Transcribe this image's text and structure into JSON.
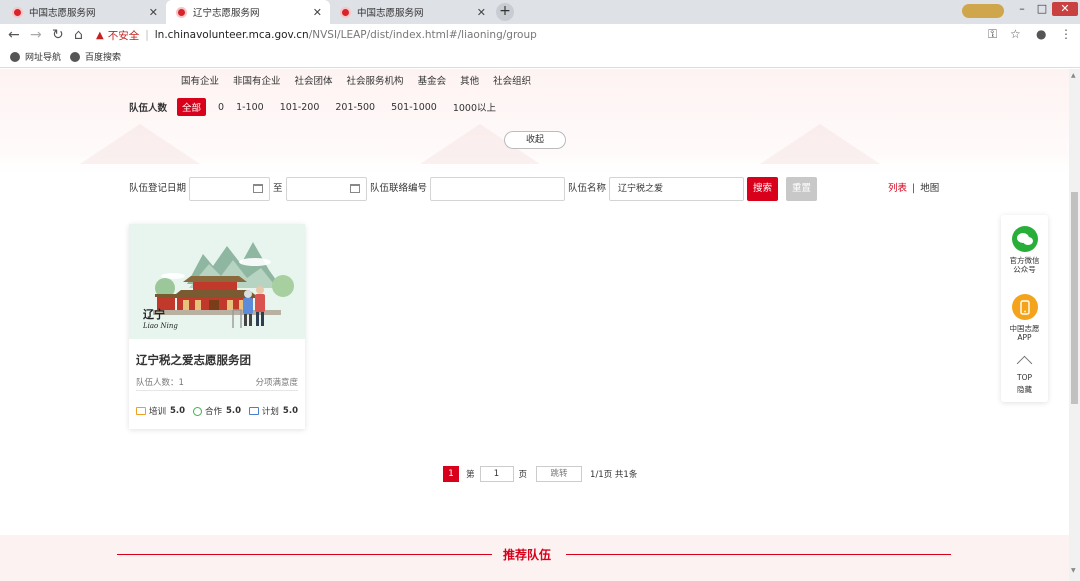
{
  "browser": {
    "tabs": [
      {
        "title": "中国志愿服务网",
        "active": false
      },
      {
        "title": "辽宁志愿服务网",
        "active": true
      },
      {
        "title": "中国志愿服务网",
        "active": false
      }
    ],
    "new_tab": "+",
    "not_secure": "不安全",
    "url_host": "ln.chinavolunteer.mca.gov.cn",
    "url_path": "/NVSI/LEAP/dist/index.html#/liaoning/group",
    "bookmarks": [
      "网址导航",
      "百度搜索"
    ]
  },
  "filters": {
    "org_types": [
      "国有企业",
      "非国有企业",
      "社会团体",
      "社会服务机构",
      "基金会",
      "其他",
      "社会组织"
    ],
    "team_size_label": "队伍人数",
    "team_size_options": [
      "全部",
      "0",
      "1-100",
      "101-200",
      "201-500",
      "501-1000",
      "1000以上"
    ],
    "selected_size": "全部",
    "collapse_label": "收起"
  },
  "search": {
    "date_label": "队伍登记日期",
    "to_label": "至",
    "contact_label": "队伍联络编号",
    "name_label": "队伍名称",
    "name_value": "辽宁税之爱",
    "search_button": "搜索",
    "reset_button": "重置",
    "view_list": "列表",
    "view_sep": "|",
    "view_map": "地图"
  },
  "card": {
    "image_caption": "辽宁",
    "image_caption_en": "Liao Ning",
    "title": "辽宁税之爱志愿服务团",
    "member_count": "队伍人数：1",
    "satisfaction_label": "分项满意度",
    "scores": [
      {
        "label": "培训",
        "value": "5.0",
        "icon": "training-icon"
      },
      {
        "label": "合作",
        "value": "5.0",
        "icon": "cooperation-icon"
      },
      {
        "label": "计划",
        "value": "5.0",
        "icon": "plan-icon"
      }
    ]
  },
  "pager": {
    "current": "1",
    "di": "第",
    "page_input": "1",
    "ye": "页",
    "jump": "跳转",
    "summary": "1/1页 共1条"
  },
  "recommend": {
    "title": "推荐队伍"
  },
  "float_bar": {
    "wechat_line1": "官方微信",
    "wechat_line2": "公众号",
    "app_line1": "中国志愿",
    "app_line2": "APP",
    "top": "TOP",
    "hide": "隐藏"
  },
  "colors": {
    "accent": "#d9001b",
    "wechat": "#2aae3a",
    "app": "#f4a41c"
  }
}
